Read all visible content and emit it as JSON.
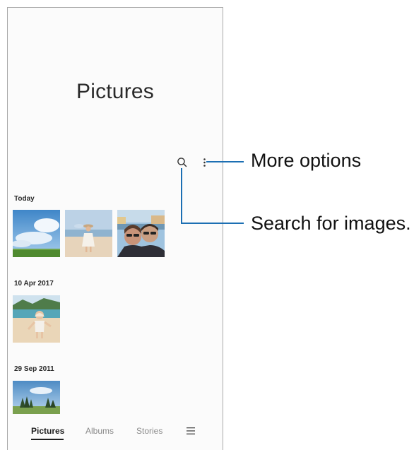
{
  "header": {
    "title": "Pictures",
    "search_icon": "search-icon",
    "more_icon": "more-vertical-icon"
  },
  "sections": [
    {
      "date": "Today",
      "photos": [
        "sky-clouds-field",
        "girl-on-beach",
        "couple-selfie-harbor"
      ]
    },
    {
      "date": "10 Apr 2017",
      "photos": [
        "child-on-beach-rocks"
      ]
    },
    {
      "date": "29 Sep 2011",
      "photos": [
        "forest-meadow-sky"
      ]
    }
  ],
  "bottom_nav": {
    "tabs": [
      {
        "label": "Pictures",
        "active": true
      },
      {
        "label": "Albums",
        "active": false
      },
      {
        "label": "Stories",
        "active": false
      }
    ],
    "menu_icon": "hamburger-menu-icon"
  },
  "callouts": {
    "more_options": "More options",
    "search": "Search for images."
  },
  "colors": {
    "callout_line": "#1c6fb3",
    "active_tab": "#1e1e1e",
    "inactive_tab": "#8a8a8a"
  }
}
